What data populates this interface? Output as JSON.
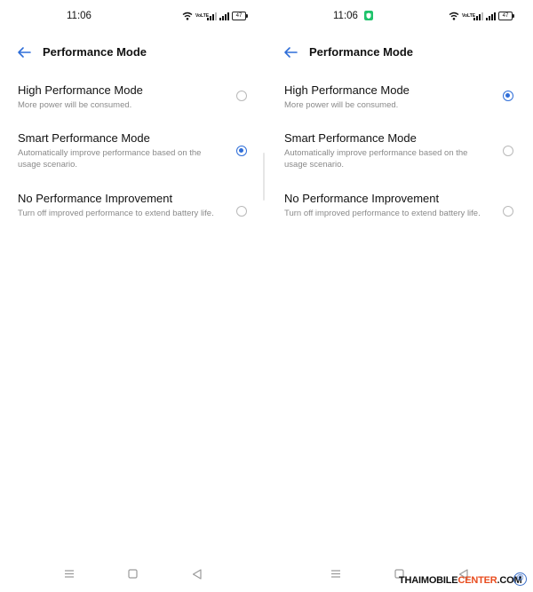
{
  "screens": [
    {
      "status": {
        "time": "11:06",
        "battery": "47",
        "volte": "VoLTE"
      },
      "header": {
        "title": "Performance Mode"
      },
      "options": [
        {
          "title": "High Performance Mode",
          "desc": "More power will be consumed.",
          "selected": false
        },
        {
          "title": "Smart Performance Mode",
          "desc": "Automatically improve performance based on the usage scenario.",
          "selected": true
        },
        {
          "title": "No Performance Improvement",
          "desc": "Turn off improved performance to extend battery life.",
          "selected": false
        }
      ]
    },
    {
      "status": {
        "time": "11:06",
        "battery": "47",
        "volte": "VoLTE"
      },
      "header": {
        "title": "Performance Mode"
      },
      "options": [
        {
          "title": "High Performance Mode",
          "desc": "More power will be consumed.",
          "selected": true
        },
        {
          "title": "Smart Performance Mode",
          "desc": "Automatically improve performance based on the usage scenario.",
          "selected": false
        },
        {
          "title": "No Performance Improvement",
          "desc": "Turn off improved performance to extend battery life.",
          "selected": false
        }
      ]
    }
  ],
  "watermark": {
    "main": "THAIMOBILE",
    "accent": "CENTER",
    "suffix": ".COM",
    "copyright": "©"
  },
  "colors": {
    "accent": "#2f6ed8",
    "shield": "#1fc36b",
    "watermark_accent": "#e84c1e"
  },
  "icons": {
    "back": "arrow-left-icon",
    "wifi": "wifi-icon",
    "signal": "signal-icon",
    "shield": "shield-icon",
    "menu": "menu-icon",
    "home": "home-icon",
    "back_nav": "back-triangle-icon"
  }
}
